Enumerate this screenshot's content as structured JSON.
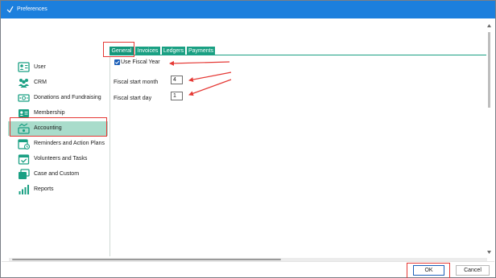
{
  "window": {
    "title": "Preferences"
  },
  "sidebar": {
    "items": [
      {
        "label": "User",
        "icon": "user-card-icon"
      },
      {
        "label": "CRM",
        "icon": "people-icon"
      },
      {
        "label": "Donations and Fundraising",
        "icon": "money-icon"
      },
      {
        "label": "Membership",
        "icon": "membership-card-icon"
      },
      {
        "label": "Accounting",
        "icon": "ledger-money-icon",
        "selected": true
      },
      {
        "label": "Reminders and Action Plans",
        "icon": "calendar-reminder-icon"
      },
      {
        "label": "Volunteers and Tasks",
        "icon": "calendar-check-icon"
      },
      {
        "label": "Case and Custom",
        "icon": "folders-icon"
      },
      {
        "label": "Reports",
        "icon": "bar-chart-icon"
      }
    ]
  },
  "tabs": [
    {
      "label": "General",
      "active": true
    },
    {
      "label": "Invoices"
    },
    {
      "label": "Ledgers"
    },
    {
      "label": "Payments"
    }
  ],
  "general": {
    "use_fiscal_year": {
      "label": "Use Fiscal Year",
      "checked": true
    },
    "fiscal_start_month": {
      "label": "Fiscal start month",
      "value": "4"
    },
    "fiscal_start_day": {
      "label": "Fiscal start day",
      "value": "1"
    }
  },
  "footer": {
    "ok_label": "OK",
    "cancel_label": "Cancel"
  },
  "colors": {
    "titlebar": "#1c7fdd",
    "accent": "#1aa083",
    "selected_item": "#a9dccb",
    "annotation_red": "#e53935",
    "checkbox": "#1c5fb8"
  }
}
